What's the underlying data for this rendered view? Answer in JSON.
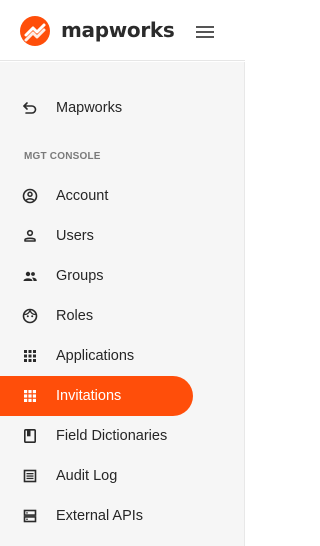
{
  "header": {
    "brand_name": "mapworks",
    "logo_icon": "mapworks-logo-icon",
    "menu_icon": "hamburger-menu-icon",
    "accent_color": "#ff4e0a"
  },
  "sidebar": {
    "back_item": {
      "label": "Mapworks",
      "icon": "back-arrow-icon"
    },
    "section_title": "MGT CONSOLE",
    "items": [
      {
        "label": "Account",
        "icon": "account-circle-icon"
      },
      {
        "label": "Users",
        "icon": "person-icon"
      },
      {
        "label": "Groups",
        "icon": "people-icon"
      },
      {
        "label": "Roles",
        "icon": "face-icon"
      },
      {
        "label": "Applications",
        "icon": "apps-grid-icon"
      },
      {
        "label": "Invitations",
        "icon": "grid-icon",
        "active": true
      },
      {
        "label": "Field Dictionaries",
        "icon": "book-icon"
      },
      {
        "label": "Audit Log",
        "icon": "list-icon"
      },
      {
        "label": "External APIs",
        "icon": "storage-icon"
      }
    ]
  }
}
